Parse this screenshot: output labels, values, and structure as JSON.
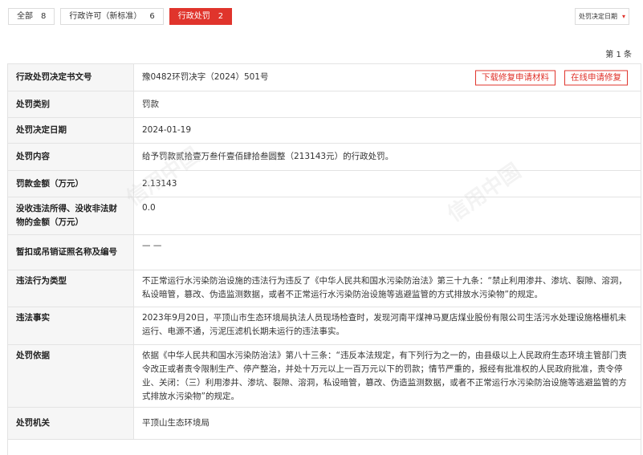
{
  "tabs": [
    {
      "label": "全部",
      "count": "8",
      "active": false
    },
    {
      "label": "行政许可（新标准）",
      "count": "6",
      "active": false
    },
    {
      "label": "行政处罚",
      "count": "2",
      "active": true
    }
  ],
  "sort": {
    "label": "处罚决定日期",
    "caret": "▾"
  },
  "pagination": {
    "text": "第 1 条"
  },
  "watermark": "信用中国",
  "actions": {
    "download_label": "下载修复申请材料",
    "online_label": "在线申请修复"
  },
  "record": [
    {
      "label": "行政处罚决定书文号",
      "value": "豫0482环罚决字（2024）501号"
    },
    {
      "label": "处罚类别",
      "value": "罚款"
    },
    {
      "label": "处罚决定日期",
      "value": "2024-01-19"
    },
    {
      "label": "处罚内容",
      "value": "给予罚款贰拾壹万叁仟壹佰肆拾叁圆整（213143元）的行政处罚。"
    },
    {
      "label": "罚款金额（万元）",
      "value": "2.13143"
    },
    {
      "label": "没收违法所得、没收非法财物的金额（万元）",
      "value": "0.0"
    },
    {
      "label": "暂扣或吊销证照名称及编号",
      "value": "— —"
    },
    {
      "label": "违法行为类型",
      "value": "不正常运行水污染防治设施的违法行为违反了《中华人民共和国水污染防治法》第三十九条：“禁止利用渗井、渗坑、裂隙、溶洞，私设暗管，篡改、伪造监测数据，或者不正常运行水污染防治设施等逃避监管的方式排放水污染物”的规定。"
    },
    {
      "label": "违法事实",
      "value": "2023年9月20日，平顶山市生态环境局执法人员现场检查时，发现河南平煤神马夏店煤业股份有限公司生活污水处理设施格栅机未运行、电源不通，污泥压滤机长期未运行的违法事实。"
    },
    {
      "label": "处罚依据",
      "value": "依据《中华人民共和国水污染防治法》第八十三条：“违反本法规定，有下列行为之一的，由县级以上人民政府生态环境主管部门责令改正或者责令限制生产、停产整治，并处十万元以上一百万元以下的罚款；情节严重的，报经有批准权的人民政府批准，责令停业、关闭：（三）利用渗井、渗坑、裂隙、溶洞，私设暗管，篡改、伪造监测数据，或者不正常运行水污染防治设施等逃避监管的方式排放水污染物”的规定。"
    },
    {
      "label": "处罚机关",
      "value": "平顶山生态环境局"
    }
  ]
}
